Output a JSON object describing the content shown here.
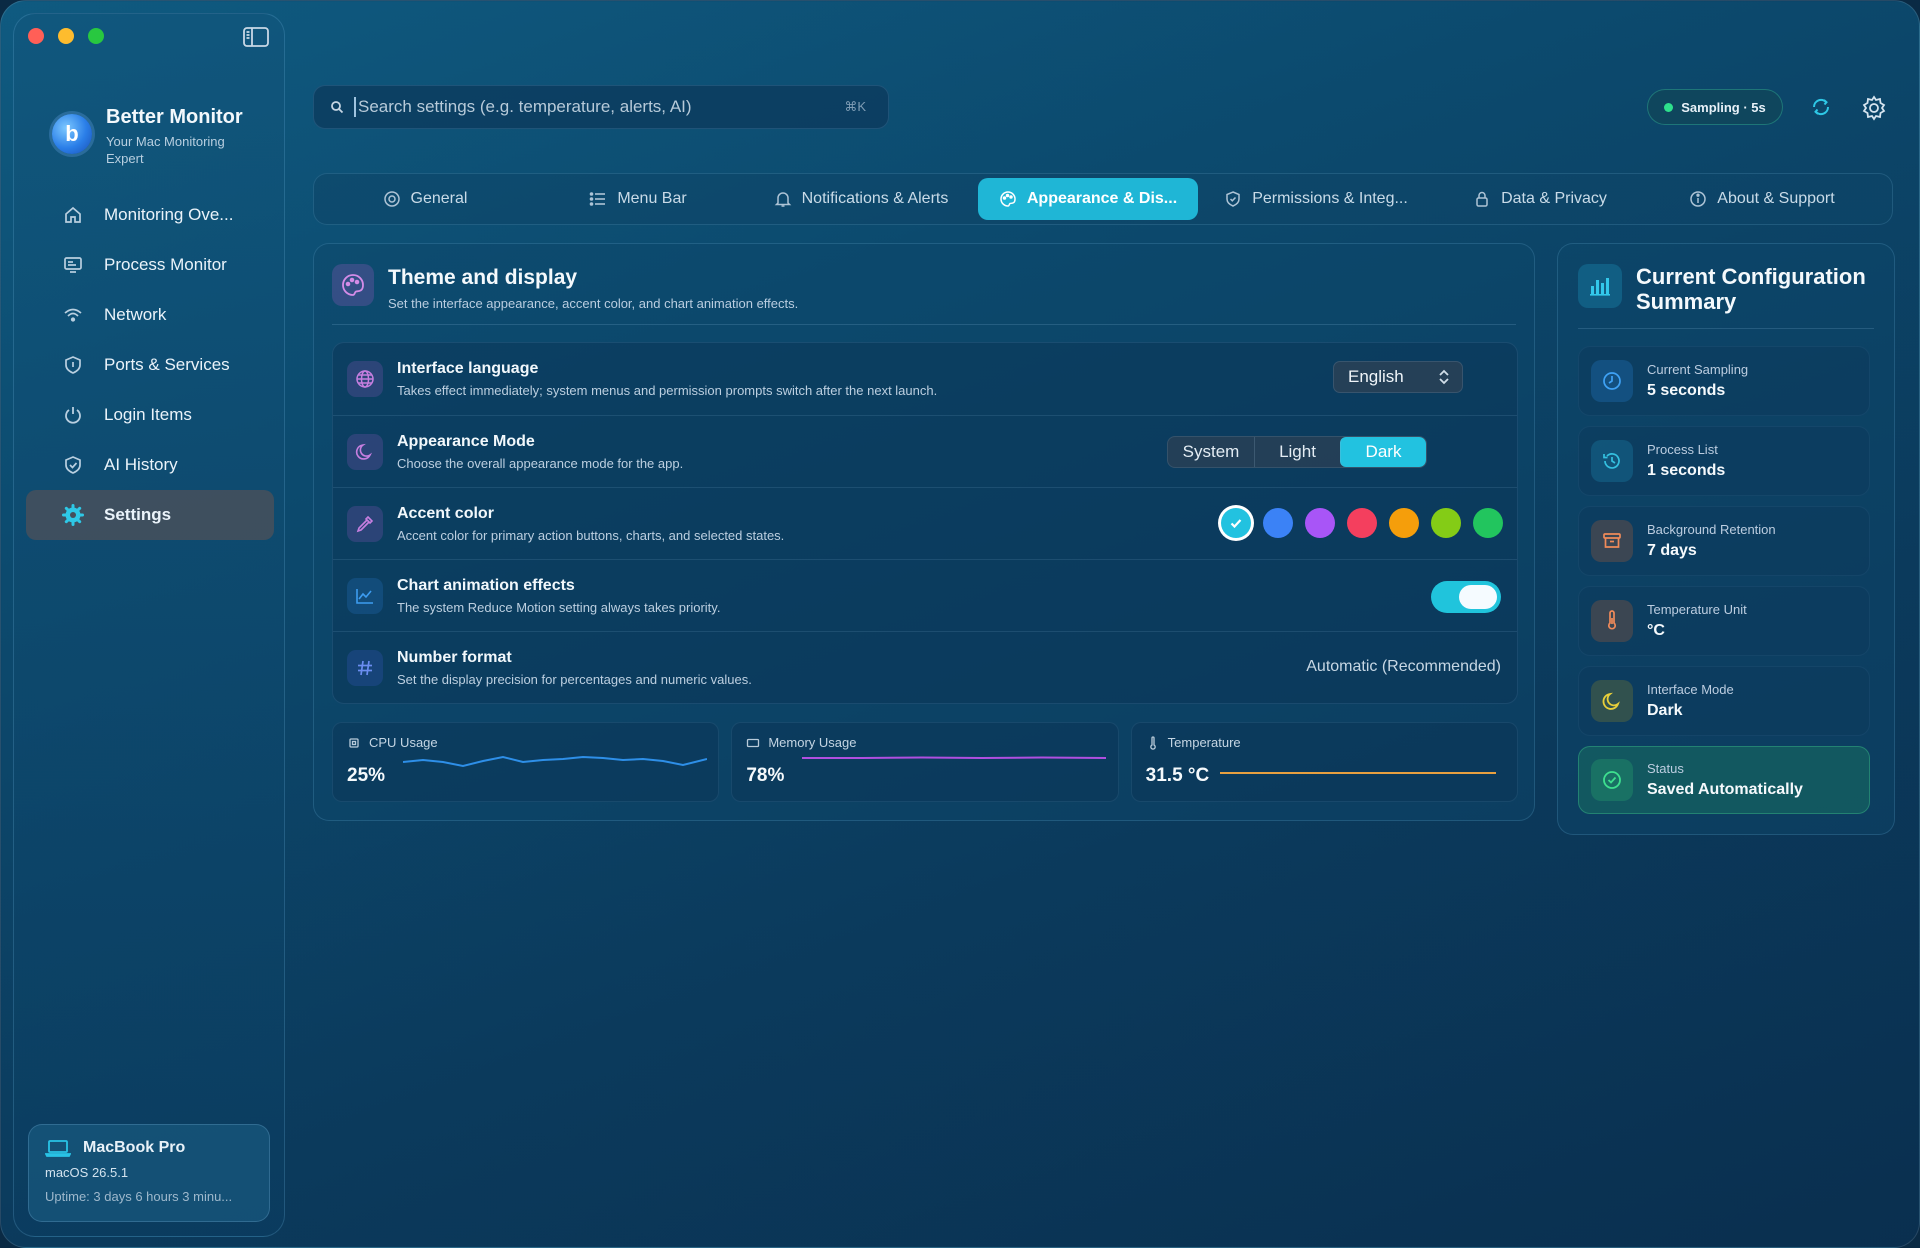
{
  "app": {
    "name": "Better Monitor",
    "tagline": "Your Mac Monitoring Expert"
  },
  "sidebar": {
    "items": [
      {
        "label": "Monitoring Ove...",
        "icon": "house-icon"
      },
      {
        "label": "Process Monitor",
        "icon": "monitor-icon"
      },
      {
        "label": "Network",
        "icon": "wifi-icon"
      },
      {
        "label": "Ports & Services",
        "icon": "shield-icon"
      },
      {
        "label": "Login Items",
        "icon": "power-icon"
      },
      {
        "label": "AI History",
        "icon": "shield-check-icon"
      },
      {
        "label": "Settings",
        "icon": "gear-icon",
        "active": true
      }
    ]
  },
  "device": {
    "name": "MacBook Pro",
    "os": "macOS 26.5.1",
    "uptime": "Uptime: 3 days 6 hours 3 minu..."
  },
  "search": {
    "placeholder": "Search settings (e.g. temperature, alerts, AI)",
    "shortcut": "⌘K"
  },
  "status": {
    "sampling": "Sampling · 5s"
  },
  "tabs": [
    {
      "label": "General",
      "icon": "gear-icon"
    },
    {
      "label": "Menu Bar",
      "icon": "list-icon"
    },
    {
      "label": "Notifications & Alerts",
      "icon": "bell-icon"
    },
    {
      "label": "Appearance & Dis...",
      "icon": "palette-icon",
      "active": true
    },
    {
      "label": "Permissions & Integ...",
      "icon": "shield-check-icon"
    },
    {
      "label": "Data & Privacy",
      "icon": "lock-icon"
    },
    {
      "label": "About & Support",
      "icon": "info-icon"
    }
  ],
  "theme_card": {
    "title": "Theme and display",
    "subtitle": "Set the interface appearance, accent color, and chart animation effects."
  },
  "settings": {
    "language": {
      "title": "Interface language",
      "desc": "Takes effect immediately; system menus and permission prompts switch after the next launch.",
      "value": "English"
    },
    "appearance": {
      "title": "Appearance Mode",
      "desc": "Choose the overall appearance mode for the app.",
      "options": [
        "System",
        "Light",
        "Dark"
      ],
      "selected": "Dark"
    },
    "accent": {
      "title": "Accent color",
      "desc": "Accent color for primary action buttons, charts, and selected states.",
      "colors": [
        "#22c2e0",
        "#3b82f6",
        "#a855f7",
        "#f43f5e",
        "#f59e0b",
        "#84cc16",
        "#22c55e"
      ],
      "selected_index": 0
    },
    "animation": {
      "title": "Chart animation effects",
      "desc": "The system Reduce Motion setting always takes priority.",
      "enabled": true
    },
    "number_format": {
      "title": "Number format",
      "desc": "Set the display precision for percentages and numeric values.",
      "value": "Automatic (Recommended)"
    }
  },
  "metrics": {
    "cpu": {
      "label": "CPU Usage",
      "value": "25%",
      "color": "#2e8fe8"
    },
    "memory": {
      "label": "Memory Usage",
      "value": "78%",
      "color": "#b04fe0"
    },
    "temperature": {
      "label": "Temperature",
      "value": "31.5 °C",
      "color": "#e8a040"
    }
  },
  "summary": {
    "title": "Current Configuration Summary",
    "items": [
      {
        "label": "Current Sampling",
        "value": "5 seconds",
        "icon": "clock-icon"
      },
      {
        "label": "Process List",
        "value": "1 seconds",
        "icon": "history-icon"
      },
      {
        "label": "Background Retention",
        "value": "7 days",
        "icon": "archive-icon"
      },
      {
        "label": "Temperature Unit",
        "value": "°C",
        "icon": "thermometer-icon"
      },
      {
        "label": "Interface Mode",
        "value": "Dark",
        "icon": "moon-icon"
      },
      {
        "label": "Status",
        "value": "Saved Automatically",
        "icon": "check-circle-icon"
      }
    ]
  }
}
